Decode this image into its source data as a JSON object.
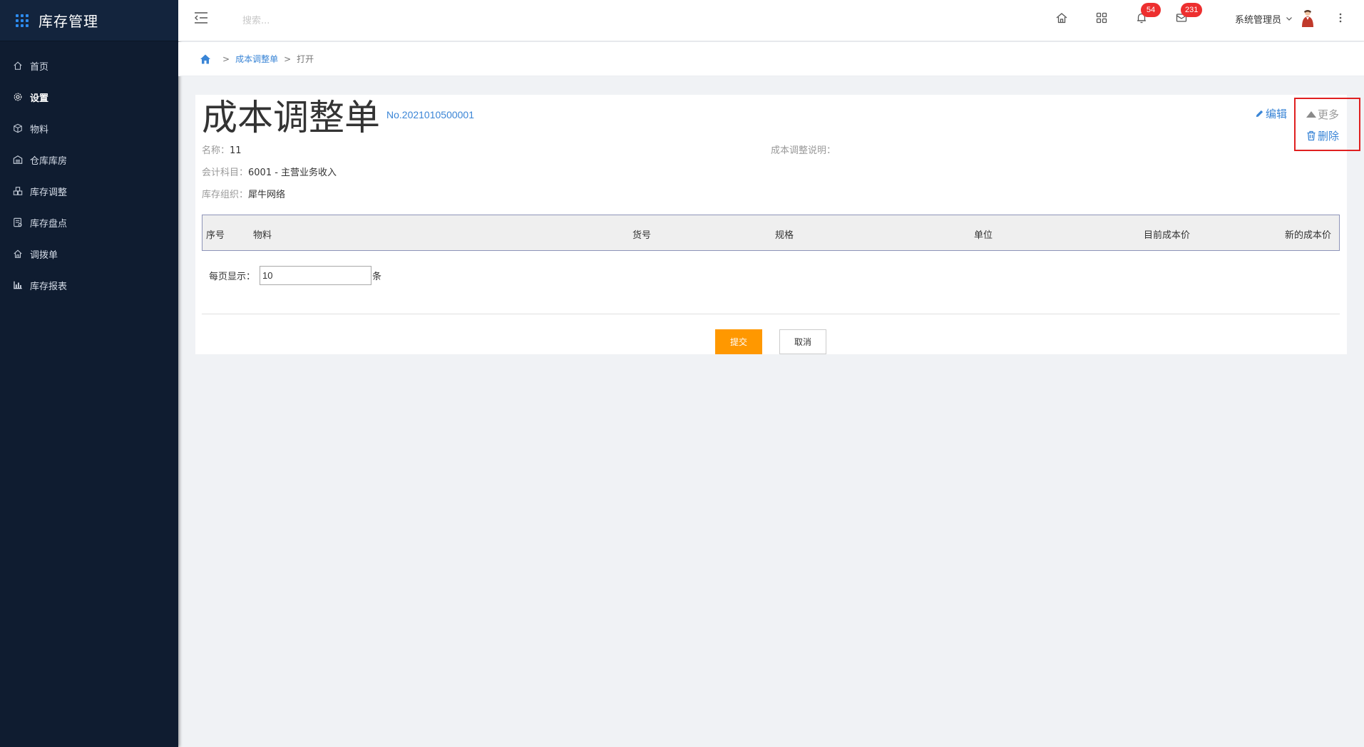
{
  "app": {
    "title": "库存管理"
  },
  "sidebar": {
    "items": [
      {
        "label": "首页",
        "icon": "home-icon"
      },
      {
        "label": "设置",
        "icon": "gear-icon",
        "active": true
      },
      {
        "label": "物料",
        "icon": "cube-icon"
      },
      {
        "label": "仓库库房",
        "icon": "warehouse-icon"
      },
      {
        "label": "库存调整",
        "icon": "boxes-icon"
      },
      {
        "label": "库存盘点",
        "icon": "checklist-icon"
      },
      {
        "label": "调拨单",
        "icon": "transfer-icon"
      },
      {
        "label": "库存报表",
        "icon": "bar-chart-icon"
      }
    ]
  },
  "header": {
    "search_placeholder": "搜索...",
    "notifications_count": "54",
    "messages_count": "231",
    "user_name": "系统管理员"
  },
  "breadcrumb": {
    "level1": "成本调整单",
    "level2": "打开",
    "separator": ">"
  },
  "document": {
    "title": "成本调整单",
    "number": "No.2021010500001",
    "edit_label": "编辑",
    "more_label": "更多",
    "delete_label": "删除",
    "name_label": "名称：",
    "name_value": "11",
    "account_label": "会计科目：",
    "account_value": "6001 - 主营业务收入",
    "org_label": "库存组织：",
    "org_value": "犀牛网络",
    "note_label": "成本调整说明：",
    "note_value": ""
  },
  "table": {
    "columns": [
      "序号",
      "物料",
      "货号",
      "规格",
      "单位",
      "目前成本价",
      "新的成本价"
    ],
    "rows": []
  },
  "pager": {
    "label": "每页显示：",
    "value": "10",
    "unit": "条"
  },
  "actions": {
    "submit_label": "提交",
    "cancel_label": "取消"
  },
  "colors": {
    "sidebar_bg": "#0f1c30",
    "accent": "#3a85d6",
    "submit": "#ff9800",
    "badge": "#ed2f2f"
  }
}
